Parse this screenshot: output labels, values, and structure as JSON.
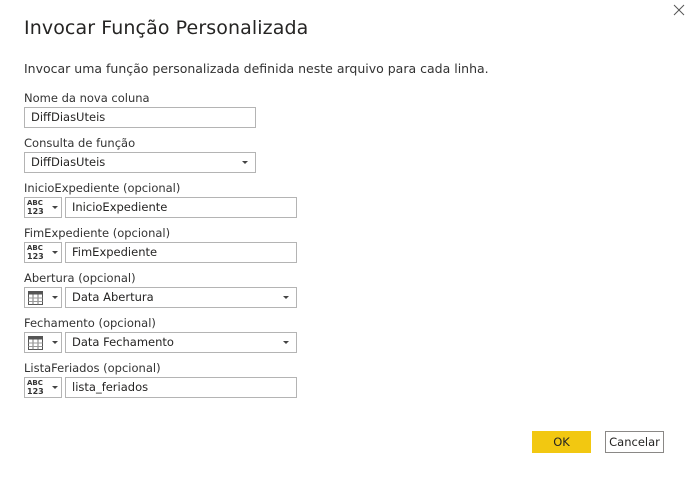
{
  "dialog": {
    "title": "Invocar Função Personalizada",
    "description": "Invocar uma função personalizada definida neste arquivo para cada linha.",
    "close_icon": "close-icon"
  },
  "fields": {
    "new_column": {
      "label": "Nome da nova coluna",
      "value": "DiffDiasUteis"
    },
    "function_query": {
      "label": "Consulta de função",
      "value": "DiffDiasUteis"
    },
    "inicio_expediente": {
      "label": "InicioExpediente (opcional)",
      "type_icon": "abc-123-icon",
      "value": "InicioExpediente"
    },
    "fim_expediente": {
      "label": "FimExpediente (opcional)",
      "type_icon": "abc-123-icon",
      "value": "FimExpediente"
    },
    "abertura": {
      "label": "Abertura (opcional)",
      "type_icon": "table-column-icon",
      "value": "Data Abertura"
    },
    "fechamento": {
      "label": "Fechamento (opcional)",
      "type_icon": "table-column-icon",
      "value": "Data Fechamento"
    },
    "lista_feriados": {
      "label": "ListaFeriados (opcional)",
      "type_icon": "abc-123-icon",
      "value": "lista_feriados"
    }
  },
  "buttons": {
    "ok_label": "OK",
    "cancel_label": "Cancelar"
  },
  "type_icon_text": {
    "abc": "ABC",
    "num": "123"
  },
  "colors": {
    "ok_button": "#f2c811",
    "border": "#b4b4b4",
    "text": "#252423"
  }
}
